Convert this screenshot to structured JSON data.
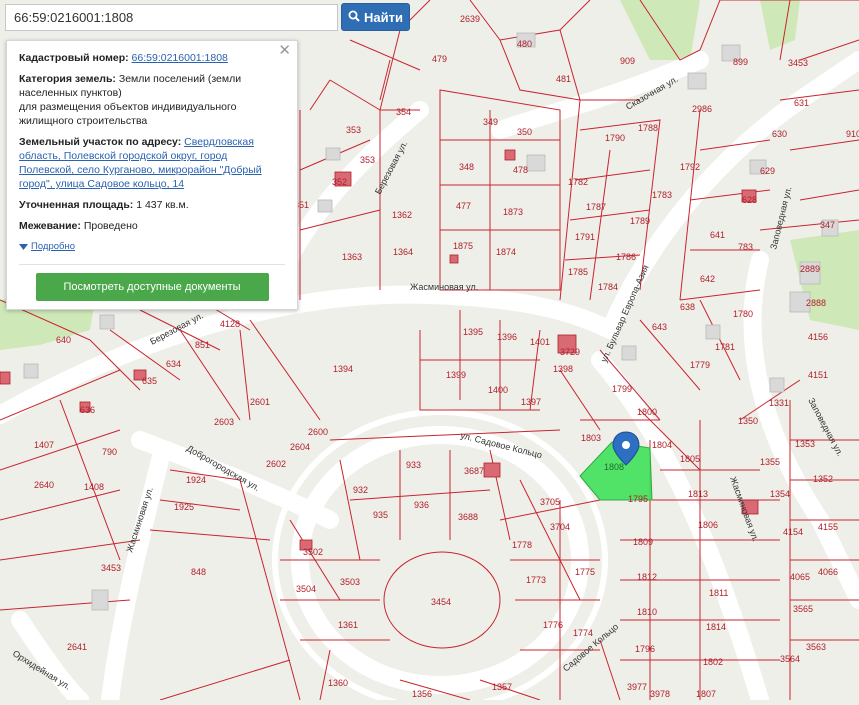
{
  "search": {
    "query": "66:59:0216001:1808",
    "button_label": "Найти"
  },
  "info": {
    "cadastral_label": "Кадастровый номер:",
    "cadastral_value": "66:59:0216001:1808",
    "category_label": "Категория земель:",
    "category_value": "Земли поселений (земли населенных пунктов)",
    "purpose_value": "для размещения объектов индивидуального жилищного строительства",
    "address_label": "Земельный участок по адресу:",
    "address_value": "Свердловская область, Полевской городской округ, город Полевской, село Курганово, микрорайон \"Добрый город\", улица Садовое кольцо, 14",
    "area_label": "Уточненная площадь:",
    "area_value": "1 437 кв.м.",
    "survey_label": "Межевание:",
    "survey_value": "Проведено",
    "more_label": "Подробно",
    "docs_button": "Посмотреть доступные документы"
  },
  "map": {
    "selected_parcel": "1808",
    "streets": [
      "Березовая ул.",
      "Жасминовая ул.",
      "ул. Садовое Кольцо",
      "Доброгородская ул.",
      "Сказочная ул.",
      "ул. Бульвар Европа-Азия",
      "Заповедная ул.",
      "Орхидейная ул."
    ],
    "parcels": [
      "2639",
      "480",
      "479",
      "481",
      "909",
      "899",
      "3453",
      "631",
      "910",
      "354",
      "353",
      "349",
      "350",
      "1790",
      "1788",
      "2986",
      "630",
      "629",
      "352",
      "348",
      "478",
      "1782",
      "1791",
      "1792",
      "628",
      "347",
      "351",
      "1362",
      "477",
      "1873",
      "1787",
      "1789",
      "1783",
      "641",
      "783",
      "1363",
      "1364",
      "1875",
      "1874",
      "1785",
      "1786",
      "1784",
      "642",
      "1780",
      "2889",
      "2888",
      "4156",
      "640",
      "4128",
      "851",
      "634",
      "635",
      "1395",
      "1396",
      "1401",
      "3729",
      "1398",
      "643",
      "638",
      "1781",
      "1779",
      "4151",
      "1394",
      "1399",
      "1400",
      "1397",
      "1799",
      "1800",
      "1331",
      "2601",
      "2603",
      "2600",
      "2604",
      "2602",
      "636",
      "790",
      "1407",
      "1408",
      "2640",
      "933",
      "3687",
      "1803",
      "1804",
      "1805",
      "1350",
      "1353",
      "932",
      "935",
      "936",
      "3688",
      "1795",
      "1813",
      "1355",
      "1352",
      "1924",
      "1925",
      "3705",
      "3704",
      "1778",
      "1773",
      "1775",
      "1809",
      "1806",
      "1354",
      "4154",
      "4155",
      "3453",
      "848",
      "3502",
      "3503",
      "3504",
      "1361",
      "3454",
      "1776",
      "1774",
      "1812",
      "1811",
      "4065",
      "4066",
      "3565",
      "2641",
      "1360",
      "1356",
      "1357",
      "1810",
      "1814",
      "1796",
      "1802",
      "3564",
      "3563",
      "3977",
      "3978",
      "1807"
    ]
  },
  "colors": {
    "accent": "#2f6db5",
    "parcel_border": "#c9242f",
    "selected_fill": "#3fe05a",
    "marker": "#2e6fc4",
    "docs_button": "#4aa84a"
  }
}
